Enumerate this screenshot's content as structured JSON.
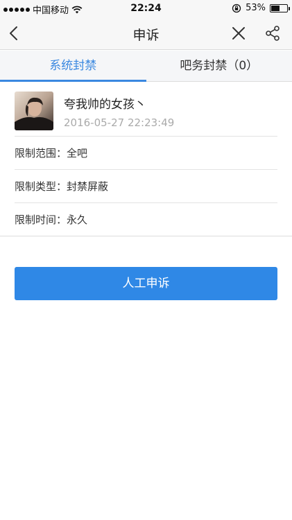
{
  "status_bar": {
    "carrier": "中国移动",
    "time": "22:24",
    "battery_percent": "53%",
    "battery_level": 0.53
  },
  "nav": {
    "title": "申诉"
  },
  "tabs": [
    {
      "label": "系统封禁",
      "active": true
    },
    {
      "label": "吧务封禁（0）",
      "active": false
    }
  ],
  "user": {
    "name": "夸我帅的女孩丶",
    "timestamp": "2016-05-27 22:23:49"
  },
  "restrictions": [
    {
      "label": "限制范围：",
      "value": "全吧"
    },
    {
      "label": "限制类型：",
      "value": "封禁屏蔽"
    },
    {
      "label": "限制时间：",
      "value": "永久"
    }
  ],
  "appeal_button": "人工申诉",
  "colors": {
    "accent": "#3a88e0",
    "button": "#2f88e6"
  }
}
